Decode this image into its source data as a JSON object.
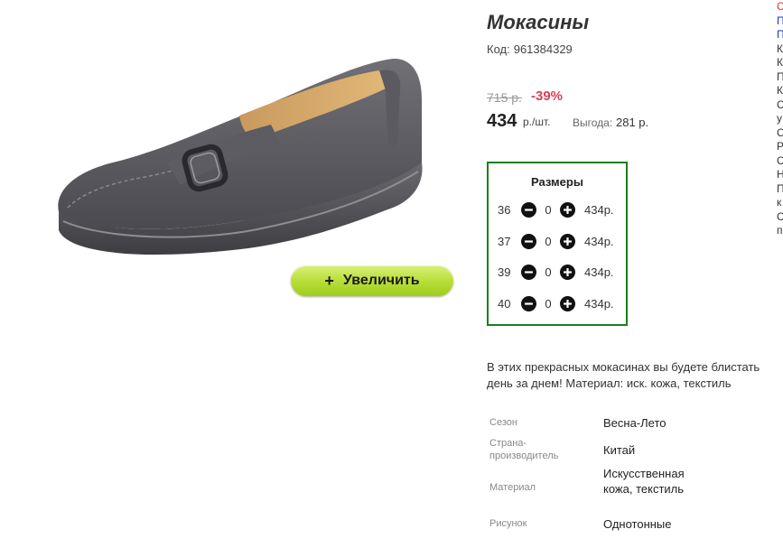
{
  "product": {
    "title": "Мокасины",
    "code_label": "Код:",
    "code": "961384329",
    "old_price": "715 р.",
    "discount": "-39%",
    "price": "434",
    "price_unit": "р./шт.",
    "savings_label": "Выгода:",
    "savings_value": "281 р.",
    "zoom_button": "Увеличить",
    "zoom_plus": "+"
  },
  "sizes": {
    "title": "Размеры",
    "rows": [
      {
        "size": "36",
        "qty": "0",
        "price": "434р."
      },
      {
        "size": "37",
        "qty": "0",
        "price": "434р."
      },
      {
        "size": "39",
        "qty": "0",
        "price": "434р."
      },
      {
        "size": "40",
        "qty": "0",
        "price": "434р."
      }
    ]
  },
  "description": {
    "line1": "В этих прекрасных мокасинах вы будете блистать",
    "line2": "день за днем! Материал: иск. кожа, текстиль"
  },
  "specs": [
    {
      "label": "Сезон",
      "value": "Весна-Лето"
    },
    {
      "label": "Страна-производитель",
      "value": "Китай"
    },
    {
      "label": "Материал",
      "value": "Искусственная кожа, текстиль"
    },
    {
      "label": "Рисунок",
      "value": "Однотонные"
    }
  ],
  "edge_letters": [
    "С",
    "П",
    "П",
    "К",
    "К",
    "П",
    "К",
    "С",
    "у",
    "С",
    "Р",
    "С",
    "Н",
    "П",
    "к",
    "С",
    "п"
  ],
  "colors": {
    "accent_green": "#1a7f1a",
    "discount_red": "#d9405a",
    "button_green": "#b9df3a"
  }
}
